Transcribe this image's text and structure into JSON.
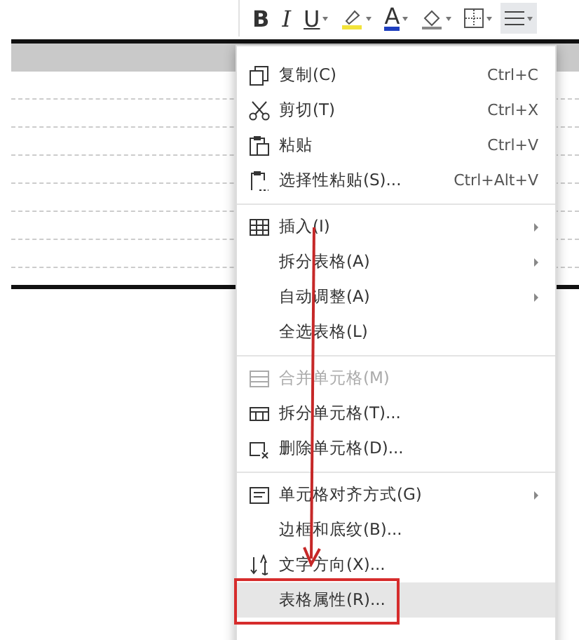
{
  "toolbar": [
    {
      "kind": "bold",
      "label": "B",
      "dropdown": false,
      "selected": false
    },
    {
      "kind": "italic",
      "label": "I",
      "dropdown": false,
      "selected": false
    },
    {
      "kind": "underline",
      "label": "U",
      "dropdown": true,
      "selected": false
    },
    {
      "kind": "highlight",
      "dropdown": true,
      "selected": false
    },
    {
      "kind": "font-color",
      "label": "A",
      "dropdown": true,
      "selected": false
    },
    {
      "kind": "shading",
      "dropdown": true,
      "selected": false
    },
    {
      "kind": "borders",
      "dropdown": true,
      "selected": false
    },
    {
      "kind": "align",
      "dropdown": true,
      "selected": true
    }
  ],
  "context_menu": {
    "groups": [
      [
        {
          "kind": "copy",
          "label": "复制(C)",
          "shortcut": "Ctrl+C",
          "submenu": false,
          "disabled": false,
          "selected": false
        },
        {
          "kind": "cut",
          "label": "剪切(T)",
          "shortcut": "Ctrl+X",
          "submenu": false,
          "disabled": false,
          "selected": false
        },
        {
          "kind": "paste",
          "label": "粘贴",
          "shortcut": "Ctrl+V",
          "submenu": false,
          "disabled": false,
          "selected": false
        },
        {
          "kind": "paste-special",
          "label": "选择性粘贴(S)...",
          "shortcut": "Ctrl+Alt+V",
          "submenu": false,
          "disabled": false,
          "selected": false
        }
      ],
      [
        {
          "kind": "table",
          "label": "插入(I)",
          "submenu": true,
          "disabled": false,
          "selected": false
        },
        {
          "kind": "plain",
          "label": "拆分表格(A)",
          "submenu": true,
          "disabled": false,
          "selected": false
        },
        {
          "kind": "plain",
          "label": "自动调整(A)",
          "submenu": true,
          "disabled": false,
          "selected": false
        },
        {
          "kind": "plain",
          "label": "全选表格(L)",
          "submenu": false,
          "disabled": false,
          "selected": false
        }
      ],
      [
        {
          "kind": "merge",
          "label": "合并单元格(M)",
          "submenu": false,
          "disabled": true,
          "selected": false
        },
        {
          "kind": "split-cells",
          "label": "拆分单元格(T)...",
          "submenu": false,
          "disabled": false,
          "selected": false
        },
        {
          "kind": "delete-cells",
          "label": "删除单元格(D)...",
          "submenu": false,
          "disabled": false,
          "selected": false
        }
      ],
      [
        {
          "kind": "align",
          "label": "单元格对齐方式(G)",
          "submenu": true,
          "disabled": false,
          "selected": false
        },
        {
          "kind": "plain",
          "label": "边框和底纹(B)...",
          "submenu": false,
          "disabled": false,
          "selected": false
        },
        {
          "kind": "direction",
          "label": "文字方向(X)...",
          "submenu": false,
          "disabled": false,
          "selected": false
        },
        {
          "kind": "plain",
          "label": "表格属性(R)...",
          "submenu": false,
          "disabled": false,
          "selected": true
        }
      ]
    ]
  }
}
